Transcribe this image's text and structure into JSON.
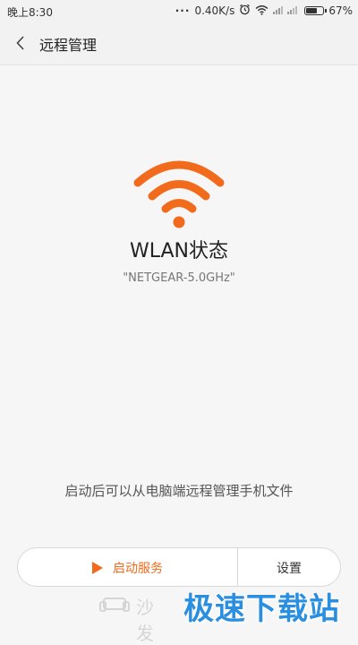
{
  "status_bar": {
    "time": "晚上8:30",
    "dots": "···",
    "speed": "0.40K/s",
    "battery": "67%",
    "battery_level": 0.67,
    "icons": [
      "alarm-icon",
      "wifi-signal-icon",
      "cell-signal-icon",
      "battery-icon"
    ]
  },
  "header": {
    "back_icon": "chevron-left-icon",
    "title": "远程管理"
  },
  "wlan": {
    "icon": "wifi-icon",
    "icon_color": "#f26b1d",
    "title": "WLAN状态",
    "network": "\"NETGEAR-5.0GHz\""
  },
  "description": "启动后可以从电脑端远程管理手机文件",
  "actions": {
    "start_label": "启动服务",
    "start_icon": "play-icon",
    "settings_label": "设置",
    "accent_color": "#f26b1d"
  },
  "watermark": {
    "left_text": "沙发",
    "text": "极速下载站",
    "color": "#2a8fe0"
  }
}
